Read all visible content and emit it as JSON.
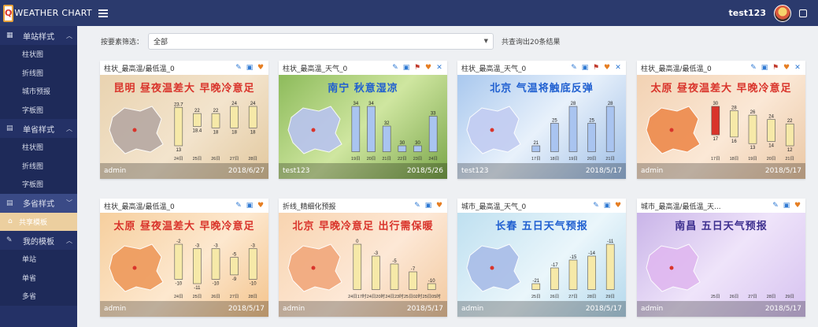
{
  "app": {
    "title": "WEATHER CHART",
    "user": "test123"
  },
  "sidebar": {
    "groups": [
      {
        "label": "单站样式",
        "items": [
          "柱状图",
          "折线图",
          "城市预报",
          "字板图"
        ]
      },
      {
        "label": "单省样式",
        "items": [
          "柱状图",
          "折线图",
          "字板图"
        ]
      },
      {
        "label": "多省样式",
        "items": []
      },
      {
        "label": "共享模板",
        "items": []
      },
      {
        "label": "我的模板",
        "items": [
          "单站",
          "单省",
          "多省"
        ]
      }
    ]
  },
  "filter": {
    "label": "按要素筛选：",
    "selected": "全部",
    "result": "共查询出20条结果"
  },
  "cards": [
    {
      "title": "柱状_最高温/最低温_0",
      "headline": "昆明  昼夜温差大 早晚冷意足",
      "user": "admin",
      "date": "2018/6/27",
      "tools": [
        "edit",
        "img",
        "fav"
      ],
      "days": [
        "24日",
        "25日",
        "26日",
        "27日",
        "28日"
      ],
      "highs": [
        "23.7",
        "22",
        "22",
        "24",
        "24"
      ],
      "lows": [
        "13",
        "18.4",
        "18",
        "18",
        "18"
      ]
    },
    {
      "title": "柱状_最高温_天气_0",
      "headline": "南宁    秋意湿凉",
      "user": "test123",
      "date": "2018/5/26",
      "tools": [
        "edit",
        "img",
        "share",
        "fav",
        "close"
      ],
      "days": [
        "19日",
        "20日",
        "21日",
        "22日",
        "23日",
        "24日"
      ],
      "highs": [
        "34",
        "34",
        "32",
        "30",
        "30",
        "33"
      ],
      "lows": []
    },
    {
      "title": "柱状_最高温_天气_0",
      "headline": "北京    气温将触底反弹",
      "user": "test123",
      "date": "2018/5/17",
      "tools": [
        "edit",
        "img",
        "share",
        "fav",
        "close"
      ],
      "days": [
        "17日",
        "18日",
        "19日",
        "20日",
        "21日"
      ],
      "highs": [
        "21",
        "25",
        "28",
        "25",
        "28"
      ],
      "lows": []
    },
    {
      "title": "柱状_最高温/最低温_0",
      "headline": "太原  昼夜温差大 早晚冷意足",
      "user": "admin",
      "date": "2018/5/17",
      "tools": [
        "edit",
        "img",
        "share",
        "fav",
        "close"
      ],
      "days": [
        "17日",
        "18日",
        "19日",
        "20日",
        "21日"
      ],
      "highs": [
        "30",
        "28",
        "26",
        "24",
        "22"
      ],
      "lows": [
        "17",
        "16",
        "13",
        "14",
        "12"
      ]
    },
    {
      "title": "柱状_最高温/最低温_0",
      "headline": "太原  昼夜温差大 早晚冷意足",
      "user": "admin",
      "date": "2018/5/17",
      "tools": [
        "edit",
        "img",
        "fav"
      ],
      "days": [
        "24日",
        "25日",
        "26日",
        "27日",
        "28日"
      ],
      "highs": [
        "-2",
        "-3",
        "-3",
        "-5",
        "-3"
      ],
      "lows": [
        "-10",
        "-11",
        "-10",
        "-9",
        "-10"
      ]
    },
    {
      "title": "折线_精细化预报",
      "headline": "北京  早晚冷意足 出行需保暖",
      "user": "admin",
      "date": "2018/5/17",
      "tools": [
        "edit",
        "img",
        "fav"
      ],
      "days": [
        "24日17时",
        "24日20时",
        "24日23时",
        "25日02时",
        "25日05时"
      ],
      "highs": [
        "0",
        "-3",
        "-5",
        "-7",
        "-10"
      ],
      "lows": []
    },
    {
      "title": "城市_最高温_天气_0",
      "headline": "长春   五日天气预报",
      "user": "admin",
      "date": "2018/5/17",
      "tools": [
        "edit",
        "img",
        "fav"
      ],
      "days": [
        "25日",
        "26日",
        "27日",
        "28日",
        "29日"
      ],
      "highs": [
        "-21",
        "-17",
        "-15",
        "-14",
        "-11"
      ],
      "lows": []
    },
    {
      "title": "城市_最高温/最低温_天...",
      "headline": "南昌   五日天气预报",
      "user": "admin",
      "date": "2018/5/17",
      "tools": [
        "edit",
        "img",
        "fav"
      ],
      "days": [
        "25日",
        "26日",
        "27日",
        "28日",
        "29日"
      ],
      "highs": [],
      "lows": []
    }
  ]
}
